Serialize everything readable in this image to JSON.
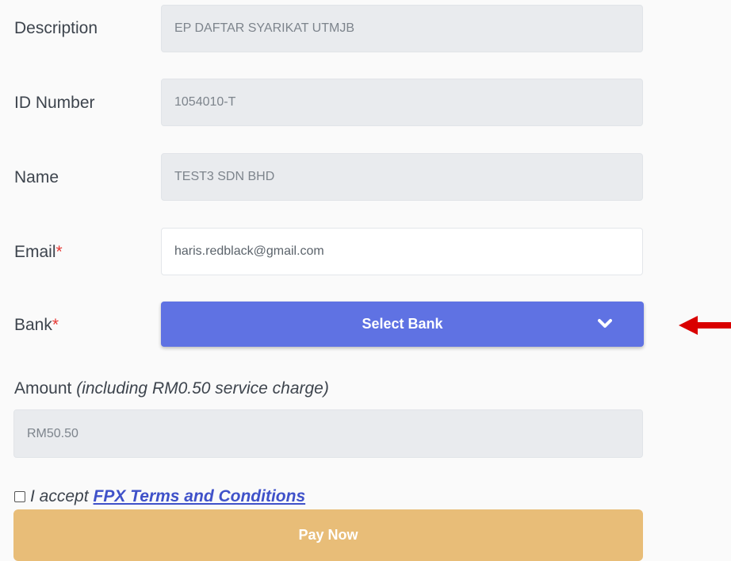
{
  "form": {
    "description": {
      "label": "Description",
      "value": "EP DAFTAR SYARIKAT UTMJB"
    },
    "id_number": {
      "label": "ID Number",
      "value": "1054010-T"
    },
    "name": {
      "label": "Name",
      "value": "TEST3 SDN BHD"
    },
    "email": {
      "label": "Email",
      "required_mark": "*",
      "value": "haris.redblack@gmail.com"
    },
    "bank": {
      "label": "Bank",
      "required_mark": "*",
      "button_label": "Select Bank"
    },
    "amount": {
      "label": "Amount",
      "note": "(including RM0.50 service charge)",
      "value": "RM50.50"
    },
    "terms": {
      "accept_text": "I accept",
      "link_text": "FPX Terms and Conditions"
    },
    "pay_button_label": "Pay Now"
  },
  "colors": {
    "select_bank_bg": "#5f72e3",
    "pay_now_bg": "#e8bd78",
    "required_mark": "#e53935",
    "annotation_arrow": "#d90000"
  }
}
